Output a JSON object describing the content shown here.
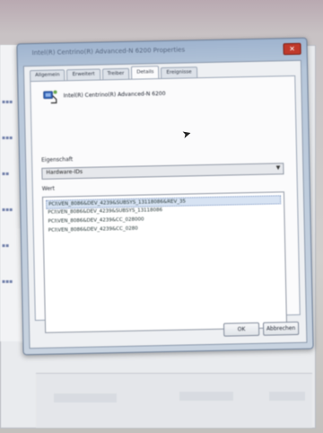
{
  "window": {
    "title": "Intel(R) Centrino(R) Advanced-N 6200 Properties",
    "close_glyph": "✕"
  },
  "tabs": [
    {
      "label": "Allgemein"
    },
    {
      "label": "Erweitert"
    },
    {
      "label": "Treiber"
    },
    {
      "label": "Details"
    },
    {
      "label": "Ereignisse"
    }
  ],
  "active_tab": 3,
  "device": {
    "name": "Intel(R) Centrino(R) Advanced-N 6200",
    "icon": "network-adapter-icon"
  },
  "property": {
    "label": "Eigenschaft",
    "value": "Hardware-IDs"
  },
  "values": {
    "label": "Wert",
    "items": [
      "PCI\\VEN_8086&DEV_4239&SUBSYS_13118086&REV_35",
      "PCI\\VEN_8086&DEV_4239&SUBSYS_13118086",
      "PCI\\VEN_8086&DEV_4239&CC_028000",
      "PCI\\VEN_8086&DEV_4239&CC_0280"
    ],
    "selected_index": 0
  },
  "buttons": {
    "ok": "OK",
    "cancel": "Abbrechen"
  },
  "colors": {
    "accent": "#9fb4cf",
    "close": "#c0392b",
    "selection": "#d7e3f3"
  }
}
